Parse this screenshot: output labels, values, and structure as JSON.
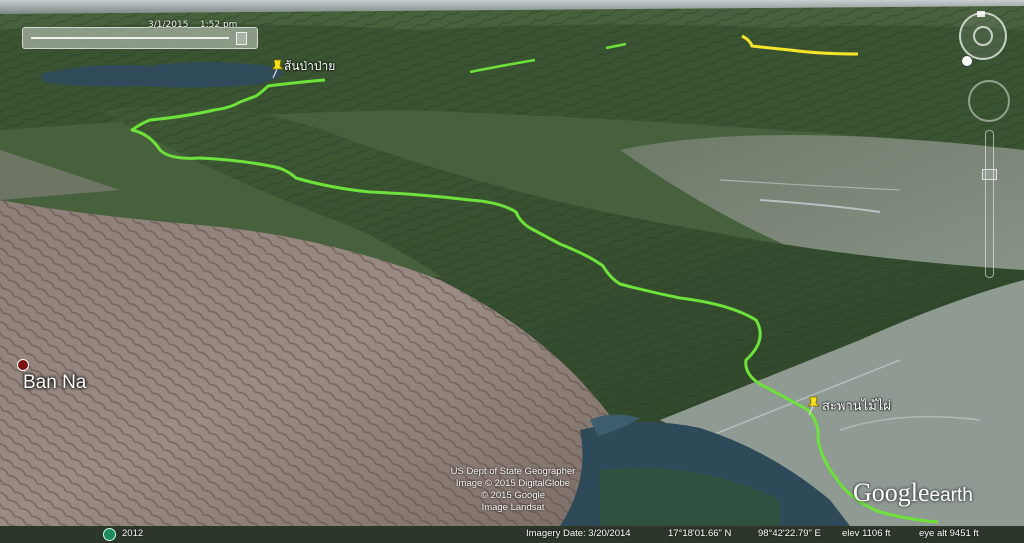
{
  "time_slider": {
    "date": "3/1/2015",
    "time": "1:52 pm"
  },
  "placemarks": [
    {
      "label": "ส้นป่าป่าย",
      "icon": "yellow-pushpin-icon"
    },
    {
      "label": "สะพานไม้ไผ่",
      "icon": "yellow-pushpin-icon"
    }
  ],
  "town": {
    "label": "Ban Na",
    "icon": "town-dot-icon"
  },
  "credits": [
    "US Dept of State Geographer",
    "Image © 2015 DigitalGlobe",
    "© 2015 Google",
    "Image Landsat"
  ],
  "logo": {
    "google": "Google",
    "earth": "earth"
  },
  "status": {
    "history_year": "2012",
    "imagery_date": "Imagery Date: 3/20/2014",
    "lat": "17°18'01.66\" N",
    "lon": "98°42'22.79\" E",
    "elev": "elev  1106 ft",
    "eye_alt": "eye alt  9451 ft"
  },
  "colors": {
    "track_green": "#6ee23a",
    "track_yellow": "#f5e52a",
    "pin_yellow": "#f7e21c"
  }
}
